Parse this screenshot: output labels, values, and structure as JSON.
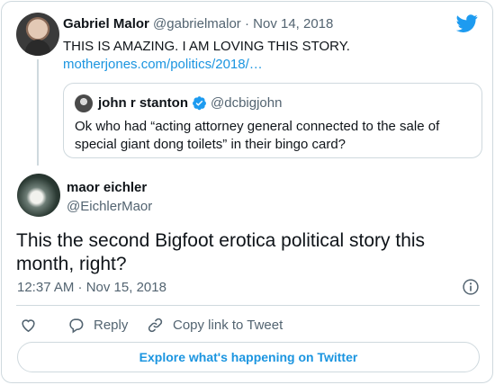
{
  "parent_tweet": {
    "name": "Gabriel Malor",
    "handle": "@gabrielmalor",
    "separator": "·",
    "date": "Nov 14, 2018",
    "text": "THIS IS AMAZING. I AM LOVING THIS STORY.",
    "link": "motherjones.com/politics/2018/…"
  },
  "quoted_tweet": {
    "name": "john r stanton",
    "handle": "@dcbigjohn",
    "verified": true,
    "text": "Ok who had “acting attorney general connected to the sale of special giant dong toilets” in their bingo card?"
  },
  "main_tweet": {
    "name": "maor eichler",
    "handle": "@EichlerMaor",
    "text": "This the second Bigfoot erotica political story this month, right?",
    "timestamp": "12:37 AM · Nov 15, 2018"
  },
  "actions": {
    "reply_label": "Reply",
    "copy_link_label": "Copy link to Tweet"
  },
  "explore_label": "Explore what's happening on Twitter",
  "colors": {
    "brand": "#1d9bf0",
    "link": "#1b95e0",
    "secondary_text": "#536471",
    "border": "#cfd9de"
  },
  "icons": [
    "twitter-bird-icon",
    "verified-badge-icon",
    "info-icon",
    "heart-icon",
    "reply-icon",
    "copy-link-icon"
  ]
}
